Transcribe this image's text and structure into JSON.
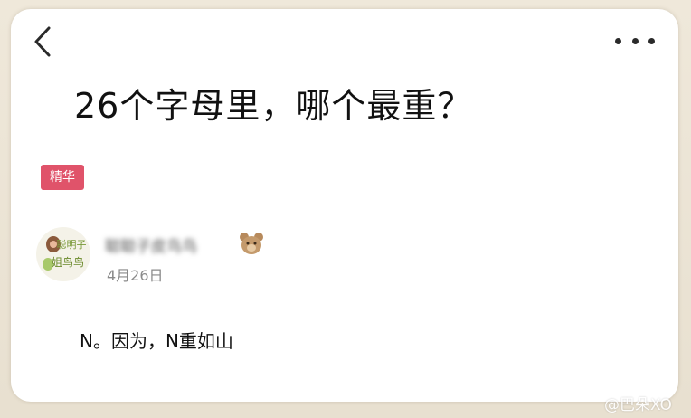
{
  "header": {
    "back_icon": "chevron-left-icon",
    "more_icon": "more-horizontal-icon"
  },
  "post": {
    "title": "26个字母里，哪个最重？",
    "badge": "精华",
    "author": {
      "name": "聪聪子皮鸟鸟",
      "avatar_text_top": "聪明子",
      "avatar_text_bottom": "姐鸟鸟",
      "emoji_icon": "bear-icon"
    },
    "date": "4月26日",
    "body": "N。因为，N重如山"
  },
  "watermark": "@巴朵XO",
  "colors": {
    "badge": "#e0536a",
    "background": "#e8e0d0",
    "card": "#ffffff"
  }
}
